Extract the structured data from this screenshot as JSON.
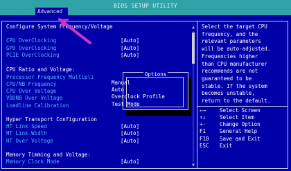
{
  "window": {
    "title": "BIOS SETUP UTILITY",
    "active_tab": "Advanced"
  },
  "sections": [
    {
      "header": "Configure System Frequency/Voltage",
      "items": [
        {
          "label": "CPU OverClocking",
          "value": "[Auto]"
        },
        {
          "label": "GPU OverClocking",
          "value": "[Auto]"
        },
        {
          "label": "PCIE OverClocking",
          "value": "[Auto]"
        }
      ]
    },
    {
      "header": "CPU Ratio and Voltage:",
      "items": [
        {
          "label": "Processor Frequency Multipli",
          "value": ""
        },
        {
          "label": "CPU/NB Frequency",
          "value": ""
        },
        {
          "label": "CPU Over Voltage",
          "value": ""
        },
        {
          "label": "VDDNB Over Voltage",
          "value": ""
        },
        {
          "label": "Loadline Calibration",
          "value": ""
        }
      ]
    },
    {
      "header": "Hyper Transport Configuration",
      "items": [
        {
          "label": "HT Link Speed",
          "value": "[Auto]"
        },
        {
          "label": "HT Link Width",
          "value": "[Auto]"
        },
        {
          "label": "HT Over Voltage",
          "value": "[Auto]"
        }
      ]
    },
    {
      "header": "Memory Timming and Voltage:",
      "items": [
        {
          "label": "Memory Clock Mode",
          "value": "[Auto]"
        }
      ]
    }
  ],
  "options_popup": {
    "title": "Options",
    "options": [
      "Manual",
      "Auto",
      "Overclock Profile",
      "Test Mode"
    ],
    "selected": "Auto"
  },
  "help_text": [
    "Select the target CPU",
    "frequency, and the",
    "relevant parameters",
    "will be auto-adjusted.",
    "Frequencies higher",
    "than CPU manufacturer",
    "recommends are not",
    "guaranteed to be",
    "stable. If the system",
    "becomes unstable,",
    "return to the default."
  ],
  "keys": [
    {
      "key": "←→",
      "desc": "Select Screen"
    },
    {
      "key": "↑↓",
      "desc": "Select Item"
    },
    {
      "key": "+-",
      "desc": "Change Option"
    },
    {
      "key": "F1",
      "desc": "General Help"
    },
    {
      "key": "F10",
      "desc": "Save and Exit"
    },
    {
      "key": "ESC",
      "desc": "Exit"
    }
  ],
  "colors": {
    "background": "#0000a8",
    "topbar": "#2fa3a7",
    "item_text": "#5ab0ff",
    "annotation_arrow": "#cc33cc"
  },
  "annotation": {
    "icon": "pointer-arrow-icon"
  }
}
